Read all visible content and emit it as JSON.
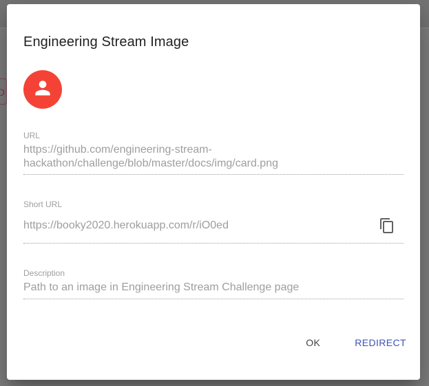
{
  "background": {
    "chip_text": "D"
  },
  "dialog": {
    "title": "Engineering Stream Image",
    "avatar_icon": "person-icon",
    "avatar_color": "#f44336",
    "fields": {
      "url": {
        "label": "URL",
        "value": "https://github.com/engineering-stream-hackathon/challenge/blob/master/docs/img/card.png"
      },
      "short_url": {
        "label": "Short URL",
        "value": "https://booky2020.herokuapp.com/r/iO0ed",
        "copy_icon": "copy-icon"
      },
      "description": {
        "label": "Description",
        "value": "Path to an image in Engineering Stream Challenge page"
      }
    },
    "actions": {
      "ok_label": "OK",
      "redirect_label": "REDIRECT",
      "redirect_color": "#3f51b5"
    }
  }
}
